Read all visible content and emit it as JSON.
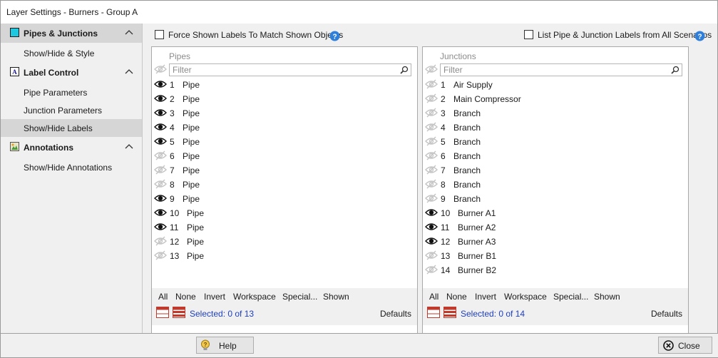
{
  "window": {
    "title": "Layer Settings - Burners - Group A"
  },
  "sidebar": {
    "sections": [
      {
        "label": "Pipes & Junctions",
        "items": [
          "Show/Hide & Style"
        ]
      },
      {
        "label": "Label Control",
        "items": [
          "Pipe Parameters",
          "Junction Parameters",
          "Show/Hide Labels"
        ]
      },
      {
        "label": "Annotations",
        "items": [
          "Show/Hide Annotations"
        ]
      }
    ],
    "active_item": "Show/Hide Labels"
  },
  "options": {
    "force_labels": {
      "label": "Force Shown Labels To Match Shown Objects",
      "checked": false
    },
    "list_all_scenarios": {
      "label": "List Pipe & Junction Labels from All Scenarios",
      "checked": false
    }
  },
  "pipes": {
    "title": "Pipes",
    "filter_placeholder": "Filter",
    "rows": [
      {
        "num": "1",
        "name": "Pipe",
        "visible": true
      },
      {
        "num": "2",
        "name": "Pipe",
        "visible": true
      },
      {
        "num": "3",
        "name": "Pipe",
        "visible": true
      },
      {
        "num": "4",
        "name": "Pipe",
        "visible": true
      },
      {
        "num": "5",
        "name": "Pipe",
        "visible": true
      },
      {
        "num": "6",
        "name": "Pipe",
        "visible": false
      },
      {
        "num": "7",
        "name": "Pipe",
        "visible": false
      },
      {
        "num": "8",
        "name": "Pipe",
        "visible": false
      },
      {
        "num": "9",
        "name": "Pipe",
        "visible": true
      },
      {
        "num": "10",
        "name": "Pipe",
        "visible": true
      },
      {
        "num": "11",
        "name": "Pipe",
        "visible": true
      },
      {
        "num": "12",
        "name": "Pipe",
        "visible": false
      },
      {
        "num": "13",
        "name": "Pipe",
        "visible": false
      }
    ],
    "actions": [
      "All",
      "None",
      "Invert",
      "Workspace",
      "Special...",
      "Shown"
    ],
    "selected_text": "Selected: 0 of 13",
    "defaults_label": "Defaults"
  },
  "junctions": {
    "title": "Junctions",
    "filter_placeholder": "Filter",
    "rows": [
      {
        "num": "1",
        "name": "Air Supply",
        "visible": false
      },
      {
        "num": "2",
        "name": "Main Compressor",
        "visible": false
      },
      {
        "num": "3",
        "name": "Branch",
        "visible": false
      },
      {
        "num": "4",
        "name": "Branch",
        "visible": false
      },
      {
        "num": "5",
        "name": "Branch",
        "visible": false
      },
      {
        "num": "6",
        "name": "Branch",
        "visible": false
      },
      {
        "num": "7",
        "name": "Branch",
        "visible": false
      },
      {
        "num": "8",
        "name": "Branch",
        "visible": false
      },
      {
        "num": "9",
        "name": "Branch",
        "visible": false
      },
      {
        "num": "10",
        "name": "Burner A1",
        "visible": true
      },
      {
        "num": "11",
        "name": "Burner A2",
        "visible": true
      },
      {
        "num": "12",
        "name": "Burner A3",
        "visible": true
      },
      {
        "num": "13",
        "name": "Burner B1",
        "visible": false
      },
      {
        "num": "14",
        "name": "Burner B2",
        "visible": false
      }
    ],
    "actions": [
      "All",
      "None",
      "Invert",
      "Workspace",
      "Special...",
      "Shown"
    ],
    "selected_text": "Selected: 0 of 14",
    "defaults_label": "Defaults"
  },
  "buttons": {
    "help": "Help",
    "close": "Close"
  },
  "icons": {
    "eye_visible": "eye-icon",
    "eye_hidden": "eye-slash-icon",
    "help": "question-circle-icon"
  },
  "colors": {
    "accent_blue": "#1f3fbf",
    "help_blue": "#2f7fd8",
    "active_item_bg": "#d6d6d6"
  }
}
